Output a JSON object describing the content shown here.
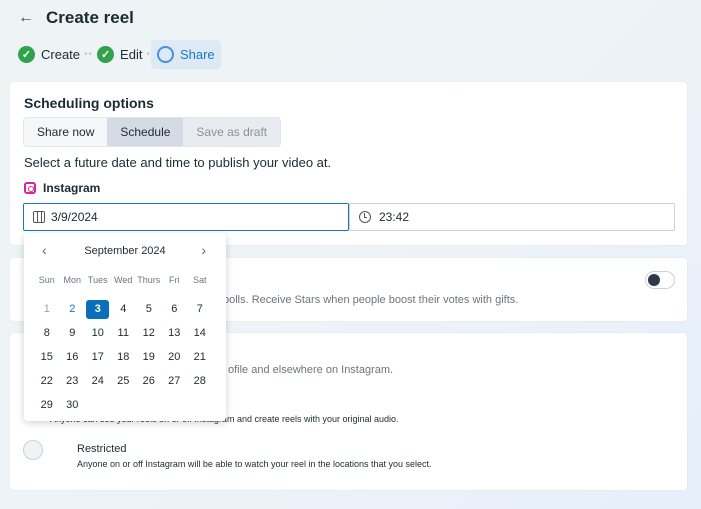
{
  "header": {
    "title": "Create reel",
    "back_icon": "arrow-left-icon"
  },
  "steps": [
    {
      "label": "Create",
      "state": "done"
    },
    {
      "label": "Edit",
      "state": "done"
    },
    {
      "label": "Share",
      "state": "active"
    }
  ],
  "scheduling": {
    "title": "Scheduling options",
    "tabs": [
      "Share now",
      "Schedule",
      "Save as draft"
    ],
    "selected_tab": "Schedule",
    "description": "Select a future date and time to publish your video at.",
    "platform": "Instagram",
    "date_value": "3/9/2024",
    "time_value": "23:42"
  },
  "polls": {
    "text": "polls. Receive Stars when people boost their votes with gifts.",
    "toggle_on": false
  },
  "audience": {
    "text": "ofile and elsewhere on Instagram.",
    "option1_desc": "Anyone can see your reels on or off Instagram and create reels with your original audio.",
    "option2_label": "Restricted",
    "option2_desc": "Anyone on or off Instagram will be able to watch your reel in the locations that you select."
  },
  "calendar": {
    "month": "September 2024",
    "weekdays": [
      "Sun",
      "Mon",
      "Tues",
      "Wed",
      "Thurs",
      "Fri",
      "Sat"
    ],
    "days": [
      1,
      2,
      3,
      4,
      5,
      6,
      7,
      8,
      9,
      10,
      11,
      12,
      13,
      14,
      15,
      16,
      17,
      18,
      19,
      20,
      21,
      22,
      23,
      24,
      25,
      26,
      27,
      28,
      29,
      30
    ],
    "today": 2,
    "selected": 3,
    "accent": "#0a6fb8"
  }
}
